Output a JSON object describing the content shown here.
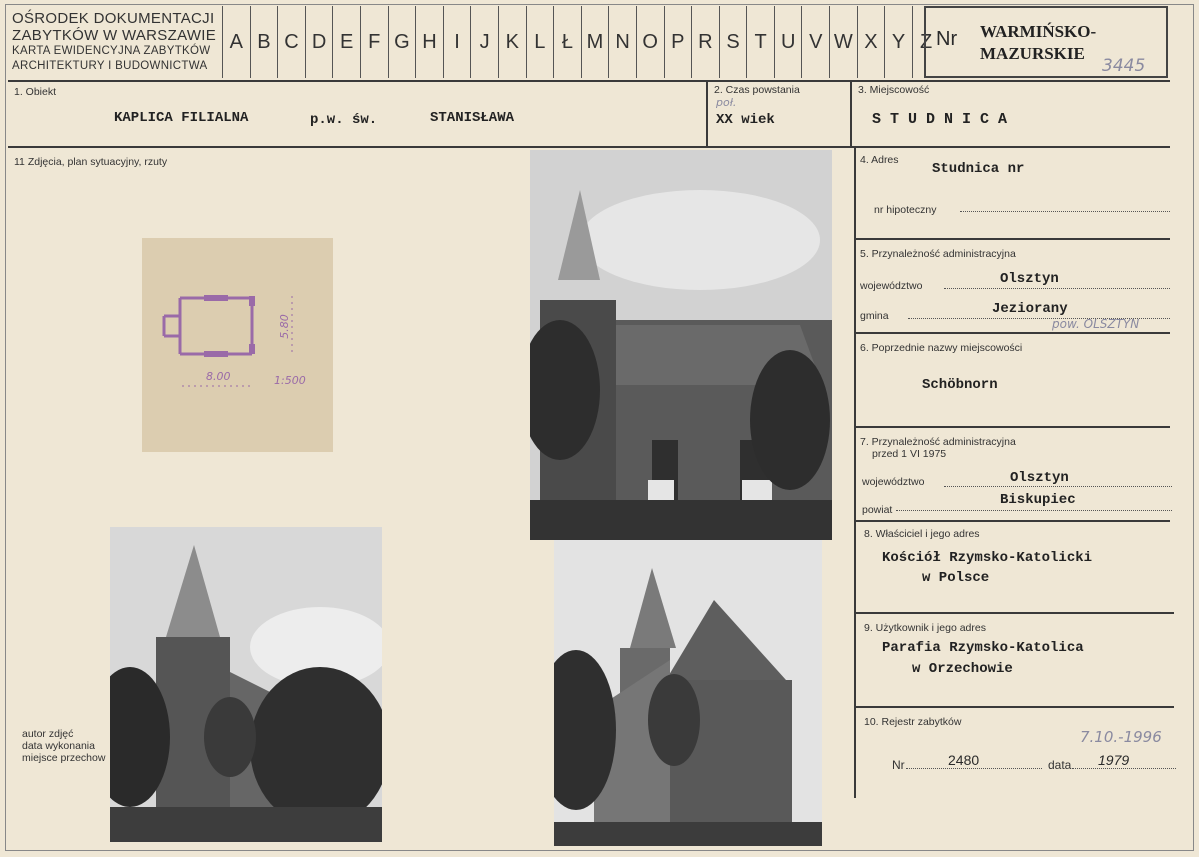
{
  "header": {
    "line1": "OŚRODEK DOKUMENTACJI",
    "line2": "ZABYTKÓW W WARSZAWIE",
    "line3": "KARTA EWIDENCYJNA ZABYTKÓW",
    "line4": "ARCHITEKTURY I BUDOWNICTWA",
    "letters": [
      "A",
      "B",
      "C",
      "D",
      "E",
      "F",
      "G",
      "H",
      "I",
      "J",
      "K",
      "L",
      "Ł",
      "M",
      "N",
      "O",
      "P",
      "R",
      "S",
      "T",
      "U",
      "V",
      "W",
      "X",
      "Y",
      "Z"
    ],
    "nr_label": "Nr",
    "region_line1": "WARMIŃSKO-",
    "region_line2": "MAZURSKIE",
    "card_number": "3445"
  },
  "fields": {
    "obiekt": {
      "label": "1. Obiekt",
      "value1": "KAPLICA FILIALNA",
      "value2": "p.w. św.",
      "value3": "STANISŁAWA"
    },
    "czas": {
      "label": "2. Czas powstania",
      "note": "poł.",
      "value": "XX wiek"
    },
    "miejscowosc": {
      "label": "3. Miejscowość",
      "value": "S T U D N I C A"
    },
    "adres": {
      "label": "4. Adres",
      "value": "Studnica nr",
      "hipoteczny_label": "nr hipoteczny"
    },
    "przynaleznosc": {
      "label": "5. Przynależność administracyjna",
      "woj_label": "województwo",
      "woj_value": "Olsztyn",
      "gmina_label": "gmina",
      "gmina_value": "Jeziorany",
      "note": "pow. OLSZTYN"
    },
    "poprzednie": {
      "label": "6. Poprzednie nazwy miejscowości",
      "value": "Schöbnorn"
    },
    "przynaleznosc_1975": {
      "label": "7. Przynależność administracyjna",
      "label2": "przed 1 VI 1975",
      "woj_label": "województwo",
      "woj_value": "Olsztyn",
      "powiat_label": "powiat",
      "powiat_value": "Biskupiec"
    },
    "wlasciciel": {
      "label": "8. Właściciel i jego adres",
      "line1": "Kościół Rzymsko-Katolicki",
      "line2": "w Polsce"
    },
    "uzytkownik": {
      "label": "9. Użytkownik i jego adres",
      "line1": "Parafia Rzymsko-Katolica",
      "line2": "w Orzechowie"
    },
    "rejestr": {
      "label": "10. Rejestr zabytków",
      "nr_label": "Nr",
      "nr_value": "2480",
      "data_label": "data",
      "data_value": "1979",
      "note": "7.10.-1996"
    },
    "zdjecia": {
      "label": "11 Zdjęcia, plan sytuacyjny, rzuty"
    }
  },
  "plan": {
    "dim_width": "8.00",
    "dim_height": "5.80",
    "scale": "1:500"
  },
  "photo_meta": {
    "line1": "autor zdjęć",
    "line2": "data wykonania",
    "line3": "miejsce przechow"
  },
  "colors": {
    "paper": "#efe7d5",
    "ink": "#2a2a2a",
    "pencil": "#8a8aa0",
    "plan_paper": "#dccdb0",
    "plan_ink": "#9a6aa8"
  }
}
